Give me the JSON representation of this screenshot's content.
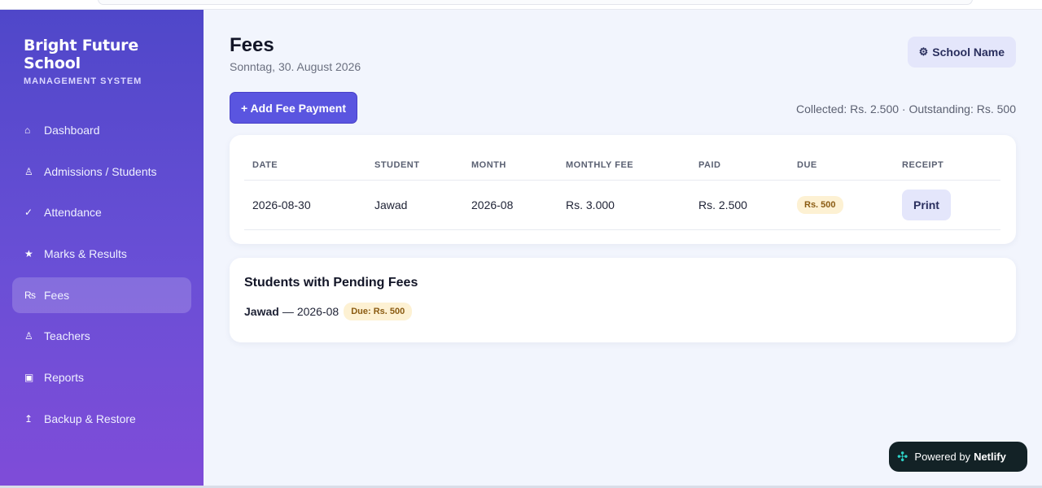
{
  "sidebar": {
    "title": "Bright Future School",
    "subtitle": "MANAGEMENT SYSTEM",
    "items": [
      {
        "icon": "⌂",
        "icon_name": "home-icon",
        "label": "Dashboard",
        "active": false
      },
      {
        "icon": "♙",
        "icon_name": "student-icon",
        "label": "Admissions / Students",
        "active": false
      },
      {
        "icon": "✓",
        "icon_name": "check-icon",
        "label": "Attendance",
        "active": false
      },
      {
        "icon": "★",
        "icon_name": "star-icon",
        "label": "Marks & Results",
        "active": false
      },
      {
        "icon": "₨",
        "icon_name": "rupee-icon",
        "label": "Fees",
        "active": true
      },
      {
        "icon": "♙",
        "icon_name": "teacher-icon",
        "label": "Teachers",
        "active": false
      },
      {
        "icon": "▣",
        "icon_name": "report-icon",
        "label": "Reports",
        "active": false
      },
      {
        "icon": "↥",
        "icon_name": "backup-icon",
        "label": "Backup & Restore",
        "active": false
      }
    ]
  },
  "header": {
    "title": "Fees",
    "date": "Sonntag, 30. August 2026",
    "school_button": "School Name",
    "school_icon": "⚙"
  },
  "toolbar": {
    "add_button": "+ Add Fee Payment",
    "summary": "Collected: Rs. 2.500 · Outstanding: Rs. 500"
  },
  "table": {
    "columns": [
      "DATE",
      "STUDENT",
      "MONTH",
      "MONTHLY FEE",
      "PAID",
      "DUE",
      "RECEIPT"
    ],
    "rows": [
      {
        "date": "2026-08-30",
        "student": "Jawad",
        "month": "2026-08",
        "monthly_fee": "Rs. 3.000",
        "paid": "Rs. 2.500",
        "due": "Rs. 500",
        "receipt": "Print"
      }
    ]
  },
  "pending": {
    "title": "Students with Pending Fees",
    "items": [
      {
        "name": "Jawad",
        "separator": "—",
        "month": "2026-08",
        "due": "Due: Rs. 500"
      }
    ]
  },
  "badge": {
    "icon": "✣",
    "prefix": "Powered by",
    "brand": "Netlify"
  },
  "colors": {
    "sidebar_top": "#4f47c9",
    "sidebar_bottom": "#7f4cd8",
    "accent": "#5a55e0",
    "main_bg": "#f2f5fd",
    "due_badge_bg": "#fdf1d3",
    "due_badge_text": "#8a5b12"
  }
}
